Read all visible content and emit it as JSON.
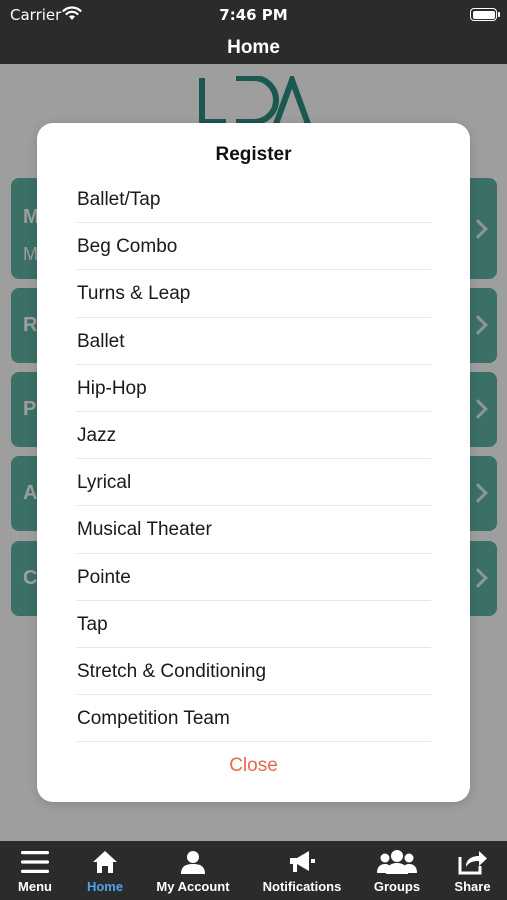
{
  "status_bar": {
    "carrier": "Carrier",
    "time": "7:46 PM"
  },
  "nav": {
    "title": "Home"
  },
  "logo": {
    "text": "LDA",
    "color": "#2d8f82"
  },
  "background_cards": [
    {
      "title": "M",
      "subtitle": "M"
    },
    {
      "title": "R",
      "subtitle": ""
    },
    {
      "title": "P",
      "subtitle": ""
    },
    {
      "title": "A",
      "subtitle": ""
    },
    {
      "title": "C",
      "subtitle": ""
    }
  ],
  "modal": {
    "title": "Register",
    "options": [
      "Ballet/Tap",
      "Beg Combo",
      "Turns & Leap",
      "Ballet",
      "Hip-Hop",
      "Jazz",
      "Lyrical",
      "Musical Theater",
      "Pointe",
      "Tap",
      "Stretch & Conditioning",
      "Competition Team"
    ],
    "close_label": "Close",
    "close_color": "#e5694d"
  },
  "tab_bar": {
    "active_color": "#4ea3ea",
    "tabs": [
      {
        "label": "Menu",
        "icon": "menu-icon",
        "active": false
      },
      {
        "label": "Home",
        "icon": "home-icon",
        "active": true
      },
      {
        "label": "My Account",
        "icon": "person-icon",
        "active": false
      },
      {
        "label": "Notifications",
        "icon": "megaphone-icon",
        "active": false
      },
      {
        "label": "Groups",
        "icon": "groups-icon",
        "active": false
      },
      {
        "label": "Share",
        "icon": "share-icon",
        "active": false
      }
    ]
  }
}
